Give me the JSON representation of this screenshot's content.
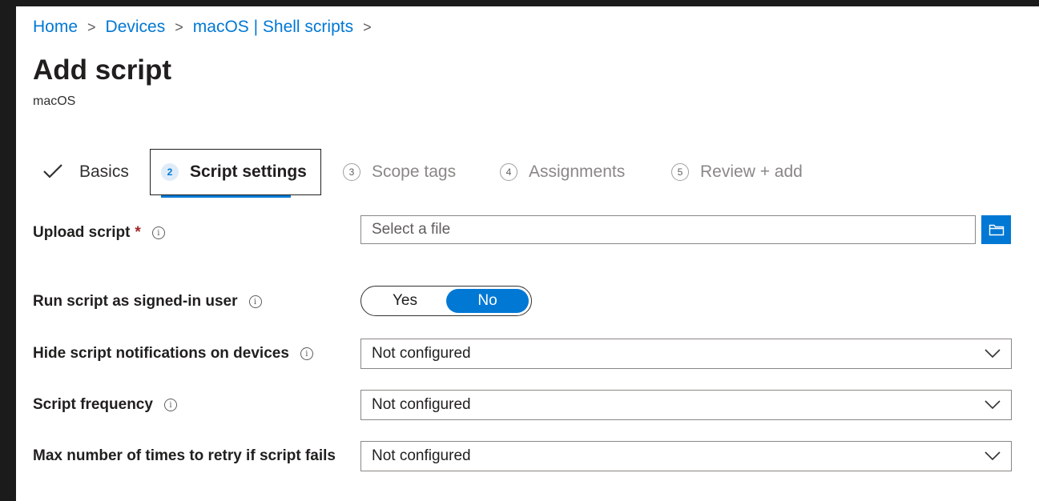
{
  "breadcrumb": {
    "items": [
      "Home",
      "Devices",
      "macOS | Shell scripts"
    ],
    "separator": ">"
  },
  "page": {
    "title": "Add script",
    "subtitle": "macOS"
  },
  "wizard": {
    "tabs": [
      {
        "label": "Basics",
        "state": "completed",
        "icon": "checkmark-icon"
      },
      {
        "number": "2",
        "label": "Script settings",
        "state": "active"
      },
      {
        "number": "3",
        "label": "Scope tags",
        "state": "upcoming"
      },
      {
        "number": "4",
        "label": "Assignments",
        "state": "upcoming"
      },
      {
        "number": "5",
        "label": "Review + add",
        "state": "upcoming"
      }
    ]
  },
  "form": {
    "upload": {
      "label": "Upload script",
      "required_mark": "*",
      "placeholder": "Select a file",
      "button_icon": "folder-icon"
    },
    "run_as_user": {
      "label": "Run script as signed-in user",
      "options": [
        "Yes",
        "No"
      ],
      "selected": "No"
    },
    "hide_notifications": {
      "label": "Hide script notifications on devices",
      "value": "Not configured"
    },
    "frequency": {
      "label": "Script frequency",
      "value": "Not configured"
    },
    "max_retries": {
      "label": "Max number of times to retry if script fails",
      "value": "Not configured"
    }
  },
  "info_glyph": "i",
  "colors": {
    "accent": "#0078d4",
    "required": "#a4262c",
    "background_outer": "#1b1b1b"
  }
}
